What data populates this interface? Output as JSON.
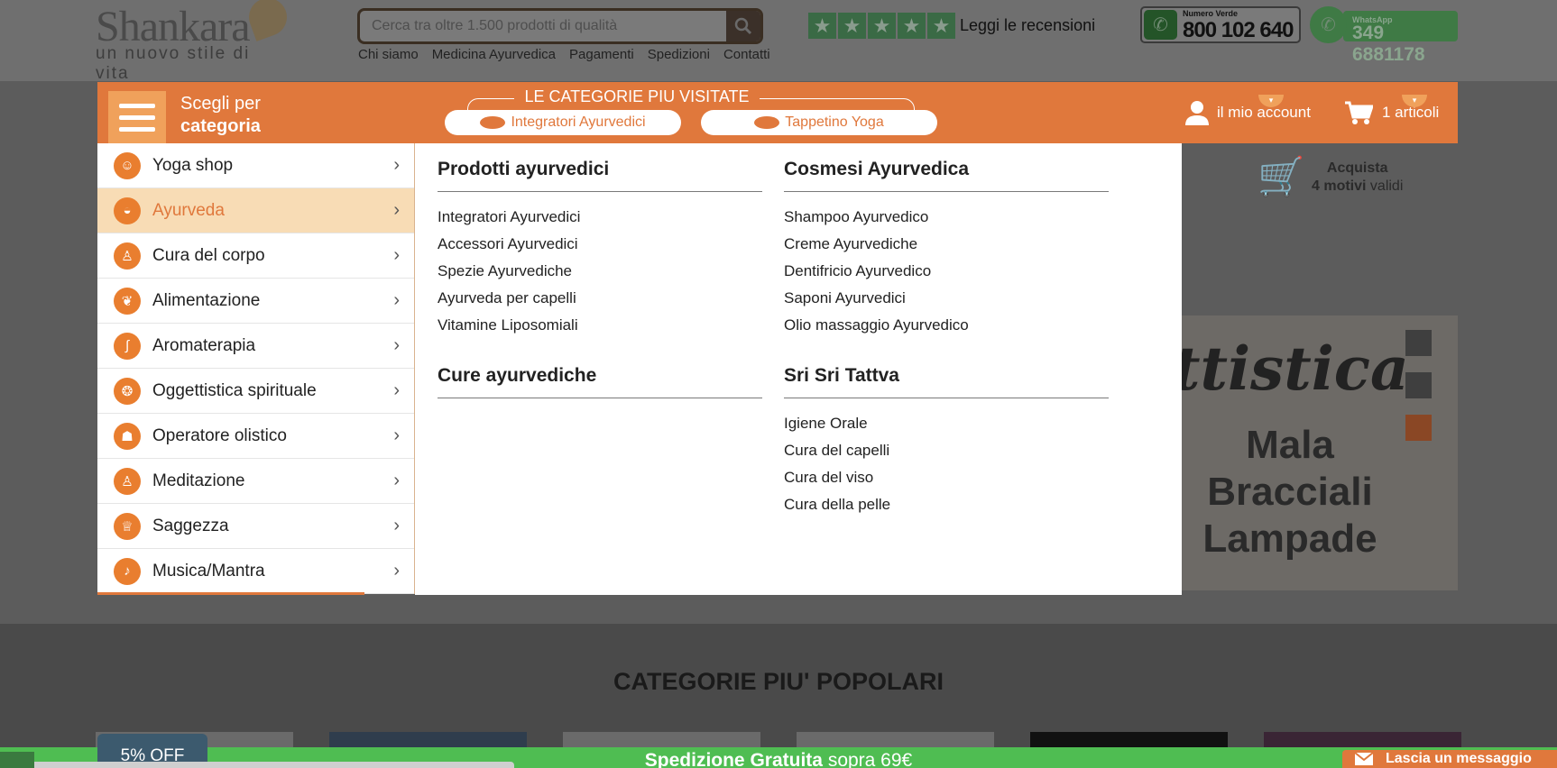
{
  "header": {
    "logo_word": "Shankara",
    "logo_tagline": "un nuovo stile di vita",
    "search_placeholder": "Cerca tra oltre 1.500 prodotti di qualità",
    "top_links": [
      "Chi siamo",
      "Medicina Ayurvedica",
      "Pagamenti",
      "Spedizioni",
      "Contatti"
    ],
    "reviews_label": "Leggi le recensioni",
    "phone_label": "Numero Verde",
    "phone_number": "800 102 640",
    "whatsapp_label": "WhatsApp",
    "whatsapp_number": "349 6881178"
  },
  "nav": {
    "category_line1": "Scegli per",
    "category_line2": "categoria",
    "visited_label": "LE CATEGORIE PIU VISITATE",
    "visited_pills": [
      "Integratori Ayurvedici",
      "Tappetino Yoga"
    ],
    "account_label": "il mio account",
    "cart_label": "1 articoli"
  },
  "sidebar": {
    "items": [
      {
        "label": "Yoga shop",
        "icon": "yoga-icon",
        "active": false
      },
      {
        "label": "Ayurveda",
        "icon": "ayurveda-icon",
        "active": true
      },
      {
        "label": "Cura del corpo",
        "icon": "body-care-icon",
        "active": false
      },
      {
        "label": "Alimentazione",
        "icon": "food-icon",
        "active": false
      },
      {
        "label": "Aromaterapia",
        "icon": "aroma-icon",
        "active": false
      },
      {
        "label": "Oggettistica spirituale",
        "icon": "spiritual-icon",
        "active": false
      },
      {
        "label": "Operatore olistico",
        "icon": "holistic-icon",
        "active": false
      },
      {
        "label": "Meditazione",
        "icon": "meditation-icon",
        "active": false
      },
      {
        "label": "Saggezza",
        "icon": "wisdom-icon",
        "active": false
      },
      {
        "label": "Musica/Mantra",
        "icon": "music-icon",
        "active": false
      }
    ]
  },
  "mega": {
    "sections": [
      {
        "title": "Prodotti ayurvedici",
        "links": [
          "Integratori Ayurvedici",
          "Accessori Ayurvedici",
          "Spezie Ayurvediche",
          "Ayurveda per capelli",
          "Vitamine Liposomiali"
        ]
      },
      {
        "title": "Cosmesi Ayurvedica",
        "links": [
          "Shampoo Ayurvedico",
          "Creme Ayurvediche",
          "Dentifricio Ayurvedico",
          "Saponi Ayurvedici",
          "Olio massaggio Ayurvedico"
        ]
      },
      {
        "title": "Cure ayurvediche",
        "links": []
      },
      {
        "title": "Sri Sri Tattva",
        "links": [
          "Igiene Orale",
          "Cura del capelli",
          "Cura del viso",
          "Cura della pelle"
        ]
      }
    ]
  },
  "background": {
    "acquista_line1": "Acquista",
    "acquista_bold": "4 motivi",
    "acquista_rest": "validi",
    "banner_script": "ttistica",
    "banner_items": [
      "Mala",
      "Bracciali",
      "Lampade"
    ],
    "popular_title": "CATEGORIE PIU' POPOLARI"
  },
  "footer": {
    "discount_tab": "5% OFF",
    "shipping_bold": "Spedizione Gratuita",
    "shipping_rest": "sopra 69€",
    "message_button": "Lascia un messaggio"
  },
  "colors": {
    "brand_orange": "#e0783c",
    "active_item_bg": "#f8dcb5",
    "shipping_green": "#4fbd52"
  }
}
